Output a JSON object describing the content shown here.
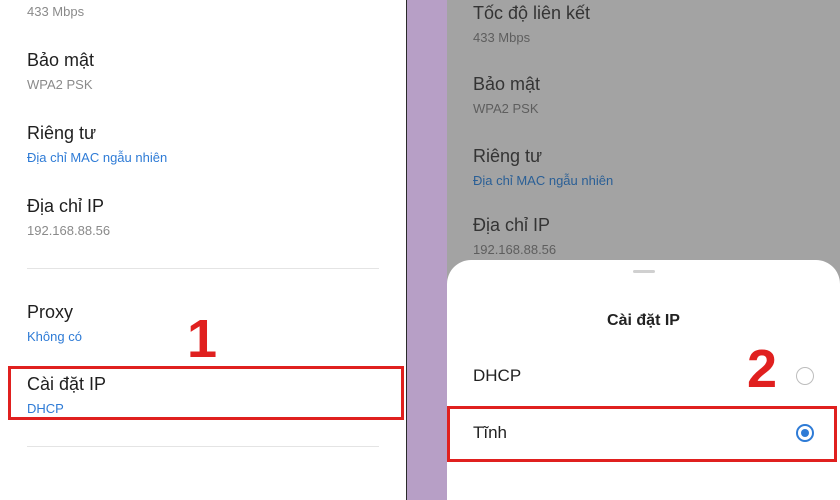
{
  "left": {
    "link_speed_value": "433 Mbps",
    "security": {
      "label": "Bảo mật",
      "value": "WPA2 PSK"
    },
    "privacy": {
      "label": "Riêng tư",
      "value": "Địa chỉ MAC ngẫu nhiên"
    },
    "ip_address": {
      "label": "Địa chỉ IP",
      "value": "192.168.88.56"
    },
    "proxy": {
      "label": "Proxy",
      "value": "Không có"
    },
    "ip_settings": {
      "label": "Cài đặt IP",
      "value": "DHCP"
    },
    "step_marker": "1"
  },
  "right": {
    "link_speed": {
      "label": "Tốc độ liên kết",
      "value": "433 Mbps"
    },
    "security": {
      "label": "Bảo mật",
      "value": "WPA2 PSK"
    },
    "privacy": {
      "label": "Riêng tư",
      "value": "Địa chỉ MAC ngẫu nhiên"
    },
    "ip_address": {
      "label": "Địa chỉ IP",
      "value": "192.168.88.56"
    },
    "step_marker": "2",
    "dialog": {
      "title": "Cài đặt IP",
      "options": [
        {
          "label": "DHCP",
          "selected": false
        },
        {
          "label": "Tĩnh",
          "selected": true
        }
      ]
    }
  },
  "colors": {
    "accent_blue": "#2e7bd6",
    "annotation_red": "#e0201f",
    "separator_purple": "#b79fc6"
  }
}
